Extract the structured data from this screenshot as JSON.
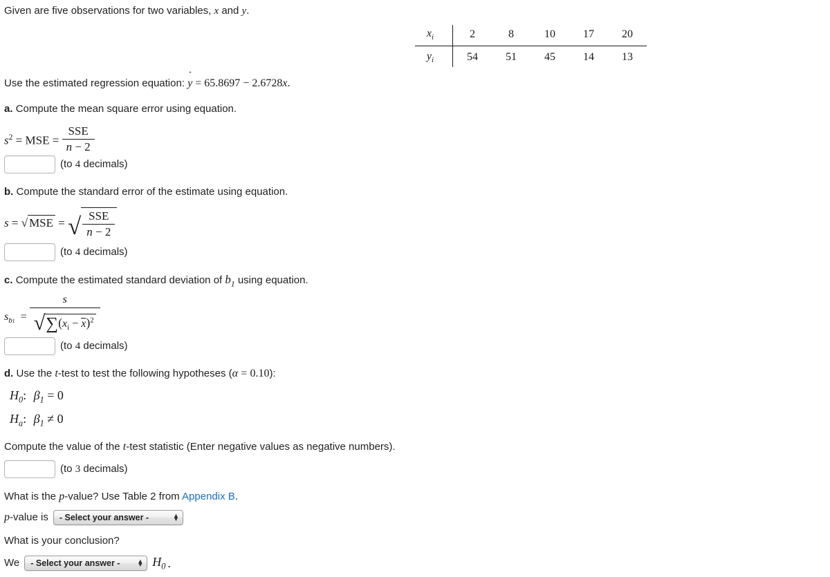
{
  "intro": {
    "text_before": "Given are five observations for two variables,",
    "var_x": "x",
    "conjunction": "and",
    "var_y": "y",
    "period": "."
  },
  "data_table": {
    "row_labels": [
      "x",
      "y"
    ],
    "row_label_sub": "i",
    "x_values": [
      "2",
      "8",
      "10",
      "17",
      "20"
    ],
    "y_values": [
      "54",
      "51",
      "45",
      "14",
      "13"
    ]
  },
  "regression": {
    "lead_text": "Use the estimated regression equation:",
    "yhat": "y",
    "equals": "=",
    "intercept": "65.8697",
    "minus": "−",
    "slope": "2.6728",
    "x_symbol": "x",
    "period": "."
  },
  "parts": {
    "a": {
      "label": "a.",
      "prompt": "Compute the mean square error using equation.",
      "formula": {
        "lhs_s": "s",
        "lhs_exp": "2",
        "eq1": "=",
        "mse": "MSE",
        "eq2": "=",
        "numerator": "SSE",
        "denominator_n": "n",
        "denominator_minus": "−",
        "denominator_two": "2"
      },
      "input_value": "",
      "input_placeholder": "",
      "hint_pre": "(to",
      "hint_num": "4",
      "hint_post": "decimals)"
    },
    "b": {
      "label": "b.",
      "prompt": "Compute the standard error of the estimate using equation.",
      "formula": {
        "lhs_s": "s",
        "eq1": "=",
        "radical_glyph": "√",
        "mse": "MSE",
        "eq2": "=",
        "numerator": "SSE",
        "denominator_n": "n",
        "denominator_minus": "−",
        "denominator_two": "2"
      },
      "input_value": "",
      "input_placeholder": "",
      "hint_pre": "(to",
      "hint_num": "4",
      "hint_post": "decimals)"
    },
    "c": {
      "label": "c.",
      "prompt_pre": "Compute the estimated standard deviation of",
      "prompt_symbol_b": "b",
      "prompt_symbol_sub": "1",
      "prompt_post": "using equation.",
      "formula": {
        "lhs_s": "s",
        "lhs_sub_b": "b",
        "lhs_sub_sub": "1",
        "eq": "=",
        "numerator": "s",
        "radical_glyph": "√",
        "sigma": "∑",
        "paren_open": "(",
        "x_i": "x",
        "x_i_sub": "i",
        "minus": "−",
        "x_bar": "x",
        "paren_close": ")",
        "exponent": "2"
      },
      "input_value": "",
      "input_placeholder": "",
      "hint_pre": "(to",
      "hint_num": "4",
      "hint_post": "decimals)"
    },
    "d": {
      "label": "d.",
      "prompt_pre": "Use the",
      "prompt_t": "t",
      "prompt_mid": "-test to test the following hypotheses (",
      "alpha": "α",
      "alpha_eq": "=",
      "alpha_value": "0.10",
      "prompt_post": "):",
      "hypotheses": [
        {
          "name": "H",
          "sub": "0",
          "colon": ":",
          "param": "β",
          "param_sub": "1",
          "relation": "=",
          "value": "0"
        },
        {
          "name": "H",
          "sub": "a",
          "colon": ":",
          "param": "β",
          "param_sub": "1",
          "relation": "≠",
          "value": "0"
        }
      ],
      "statistic_prompt_pre": "Compute the value of the",
      "statistic_prompt_t": "t",
      "statistic_prompt_post": "-test statistic (Enter negative values as negative numbers).",
      "input_value": "",
      "input_placeholder": "",
      "hint_pre": "(to",
      "hint_num": "3",
      "hint_post": "decimals)",
      "pvalue_question_pre": "What is the",
      "pvalue_question_p": "p",
      "pvalue_question_mid": "-value? Use Table 2 from",
      "pvalue_link": "Appendix B",
      "pvalue_question_post": ".",
      "pvalue_label_p": "p",
      "pvalue_label_rest": "-value is",
      "pvalue_select": {
        "selected": "- Select your answer -",
        "options": [
          "- Select your answer -"
        ]
      },
      "conclusion_question": "What is your conclusion?",
      "conclusion_lead": "We",
      "conclusion_select": {
        "selected": "- Select your answer -",
        "options": [
          "- Select your answer -"
        ]
      },
      "conclusion_h0": "H",
      "conclusion_h0_sub": "0",
      "conclusion_period": "."
    }
  },
  "colors": {
    "text": "#222222",
    "link": "#1a6fc4",
    "rule": "#1a1a1a",
    "input_border": "#b3b3b3"
  }
}
